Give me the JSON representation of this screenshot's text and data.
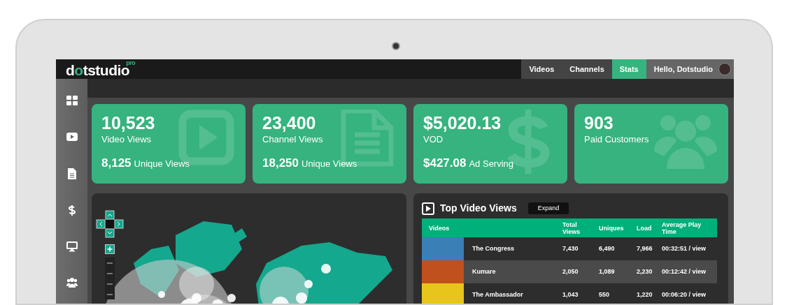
{
  "logo": {
    "text": "dotstudio",
    "badge": "pro"
  },
  "nav": [
    {
      "label": "Videos",
      "selected": false
    },
    {
      "label": "Channels",
      "selected": false
    },
    {
      "label": "Stats",
      "selected": true
    }
  ],
  "user": {
    "greeting": "Hello, Dotstudio"
  },
  "stats": [
    {
      "kind": "video",
      "value": "10,523",
      "label": "Video Views",
      "sub_value": "8,125",
      "sub_label": "Unique Views"
    },
    {
      "kind": "document",
      "value": "23,400",
      "label": "Channel Views",
      "sub_value": "18,250",
      "sub_label": "Unique Views"
    },
    {
      "kind": "dollar",
      "value": "$5,020.13",
      "label": "VOD",
      "sub_value": "$427.08",
      "sub_label": "Ad Serving"
    },
    {
      "kind": "users",
      "value": "903",
      "label": "Paid Customers"
    }
  ],
  "top_videos": {
    "title": "Top Video Views",
    "expand_button": "Expand",
    "columns": [
      "Videos",
      "Total Views",
      "Uniques",
      "Load",
      "Average Play Time"
    ],
    "rows": [
      {
        "video": "The Congress",
        "total_views": "7,430",
        "uniques": "6,490",
        "load": "7,966",
        "avg_play_time": "00:32:51 / view",
        "selected": false,
        "color": "#3a7fb5"
      },
      {
        "video": "Kumare",
        "total_views": "2,050",
        "uniques": "1,089",
        "load": "2,230",
        "avg_play_time": "00:12:42 / view",
        "selected": true,
        "color": "#c0501e"
      },
      {
        "video": "The Ambassador",
        "total_views": "1,043",
        "uniques": "550",
        "load": "1,220",
        "avg_play_time": "00:06:20 / view",
        "selected": false,
        "color": "#e8c51a"
      }
    ]
  }
}
